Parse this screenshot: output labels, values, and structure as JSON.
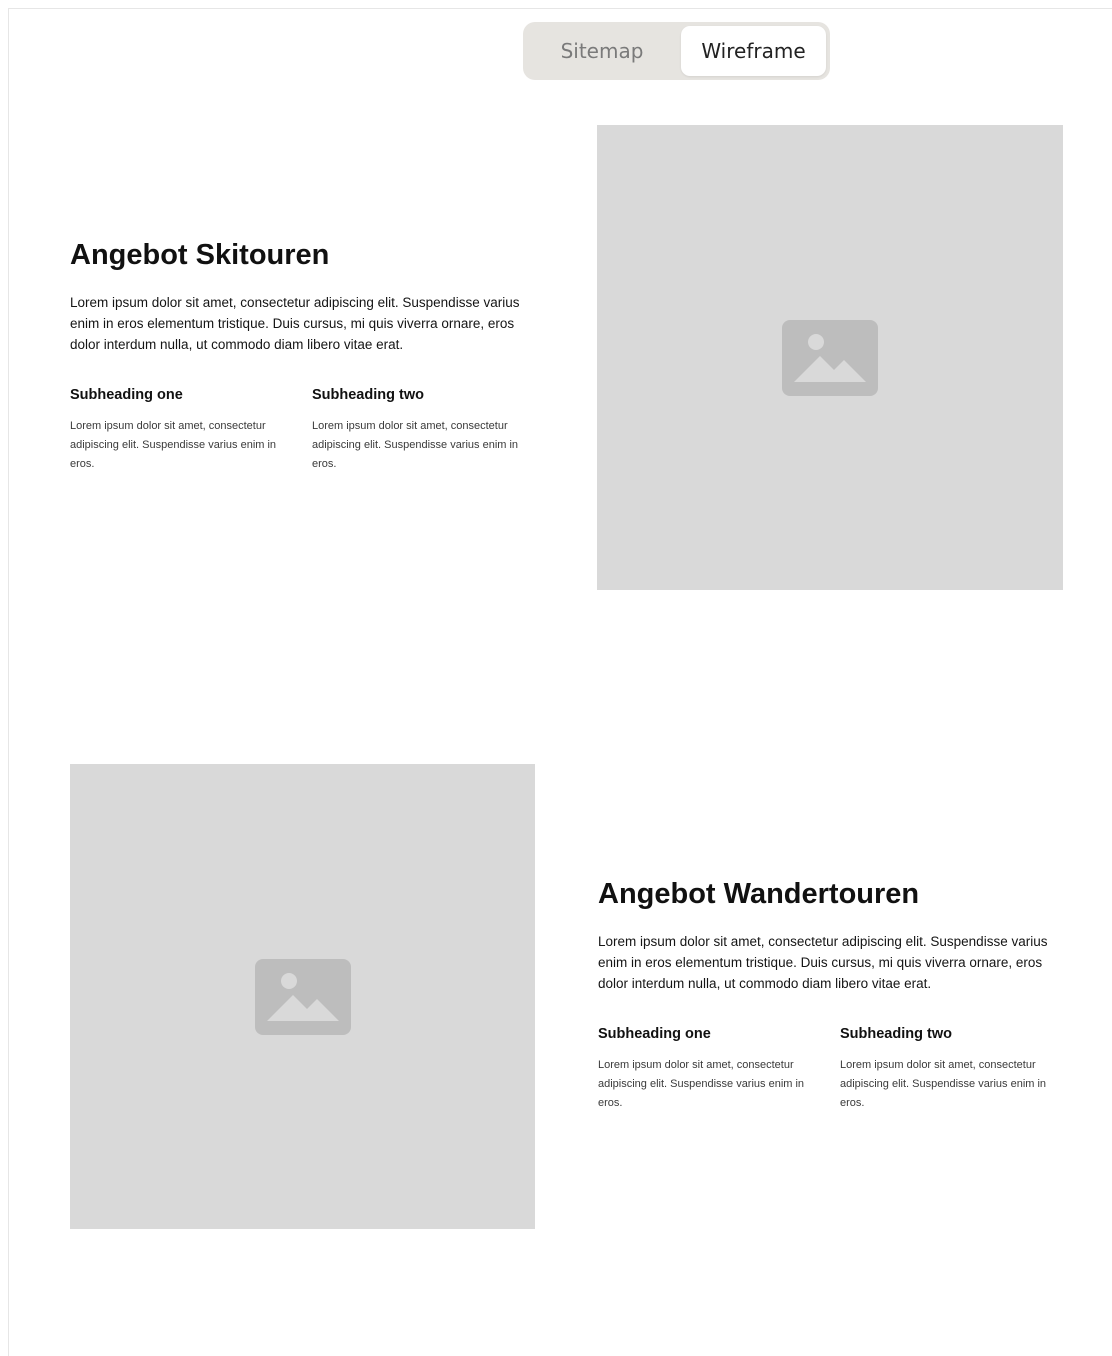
{
  "toggle": {
    "sitemap_label": "Sitemap",
    "wireframe_label": "Wireframe",
    "selected": "Wireframe"
  },
  "sections": [
    {
      "title": "Angebot Skitouren",
      "text": "Lorem ipsum dolor sit amet, consectetur adipiscing elit. Suspendisse varius enim in eros elementum tristique. Duis cursus, mi quis viverra ornare, eros dolor interdum nulla, ut commodo diam libero vitae erat.",
      "columns": [
        {
          "heading": "Subheading one",
          "text": "Lorem ipsum dolor sit amet, consectetur adipiscing elit. Suspendisse varius enim in eros."
        },
        {
          "heading": "Subheading two",
          "text": "Lorem ipsum dolor sit amet, consectetur adipiscing elit. Suspendisse varius enim in eros."
        }
      ],
      "image_icon": "image-placeholder-icon"
    },
    {
      "title": "Angebot Wandertouren",
      "text": "Lorem ipsum dolor sit amet, consectetur adipiscing elit. Suspendisse varius enim in eros elementum tristique. Duis cursus, mi quis viverra ornare, eros dolor interdum nulla, ut commodo diam libero vitae erat.",
      "columns": [
        {
          "heading": "Subheading one",
          "text": "Lorem ipsum dolor sit amet, consectetur adipiscing elit. Suspendisse varius enim in eros."
        },
        {
          "heading": "Subheading two",
          "text": "Lorem ipsum dolor sit amet, consectetur adipiscing elit. Suspendisse varius enim in eros."
        }
      ],
      "image_icon": "image-placeholder-icon"
    }
  ],
  "colors": {
    "placeholder_bg": "#d9d9d9",
    "placeholder_icon": "#bdbdbd",
    "toggle_bg": "#e6e4e0"
  }
}
